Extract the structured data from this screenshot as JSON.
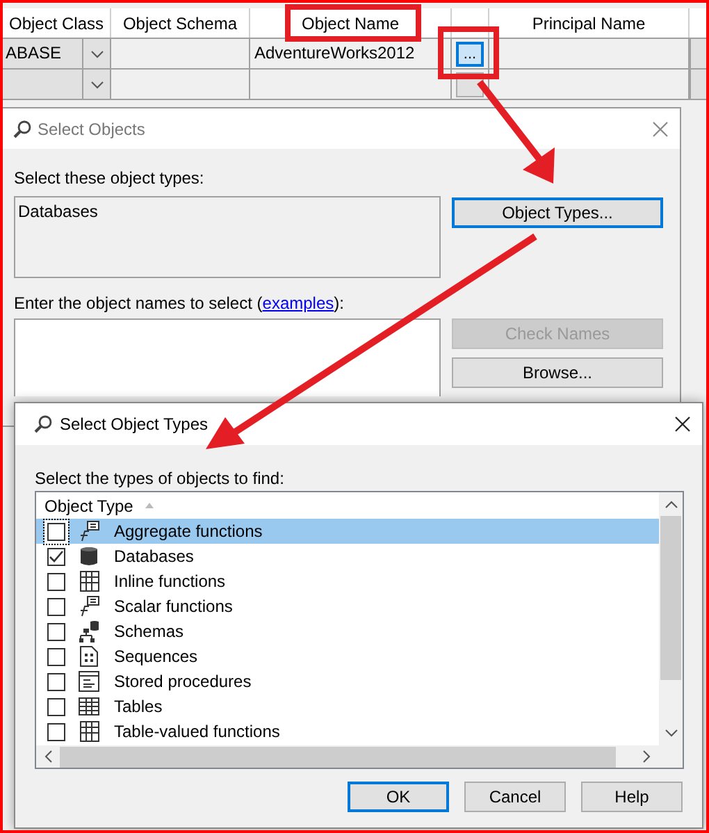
{
  "grid": {
    "columns": [
      "Object Class",
      "Object Schema",
      "Object Name",
      "Principal Name"
    ],
    "rows": [
      {
        "object_class": "ABASE",
        "object_name": "AdventureWorks2012",
        "browse_button": "...",
        "browse_focused": true
      },
      {
        "browse_focused": false
      }
    ]
  },
  "select_objects": {
    "title": "Select Objects",
    "types_label": "Select these object types:",
    "types_value": "Databases",
    "object_types_button": "Object Types...",
    "names_label_before": "Enter the object names to select (",
    "names_link": "examples",
    "names_label_after": "):",
    "buttons": [
      {
        "label": "Check Names",
        "disabled": true
      },
      {
        "label": "Browse...",
        "disabled": false
      }
    ]
  },
  "select_object_types": {
    "title": "Select Object Types",
    "label": "Select the types of objects to find:",
    "column": "Object Type",
    "items": [
      {
        "label": "Aggregate functions",
        "kind": "function",
        "checked": false,
        "selected": true
      },
      {
        "label": "Databases",
        "kind": "database",
        "checked": true,
        "selected": false
      },
      {
        "label": "Inline functions",
        "kind": "inline",
        "checked": false,
        "selected": false
      },
      {
        "label": "Scalar functions",
        "kind": "function",
        "checked": false,
        "selected": false
      },
      {
        "label": "Schemas",
        "kind": "schema",
        "checked": false,
        "selected": false
      },
      {
        "label": "Sequences",
        "kind": "sequence",
        "checked": false,
        "selected": false
      },
      {
        "label": "Stored procedures",
        "kind": "procedure",
        "checked": false,
        "selected": false
      },
      {
        "label": "Tables",
        "kind": "table",
        "checked": false,
        "selected": false
      },
      {
        "label": "Table-valued functions",
        "kind": "inline",
        "checked": false,
        "selected": false
      }
    ],
    "buttons": [
      {
        "label": "OK",
        "default": true
      },
      {
        "label": "Cancel",
        "default": false
      },
      {
        "label": "Help",
        "default": false
      }
    ]
  }
}
